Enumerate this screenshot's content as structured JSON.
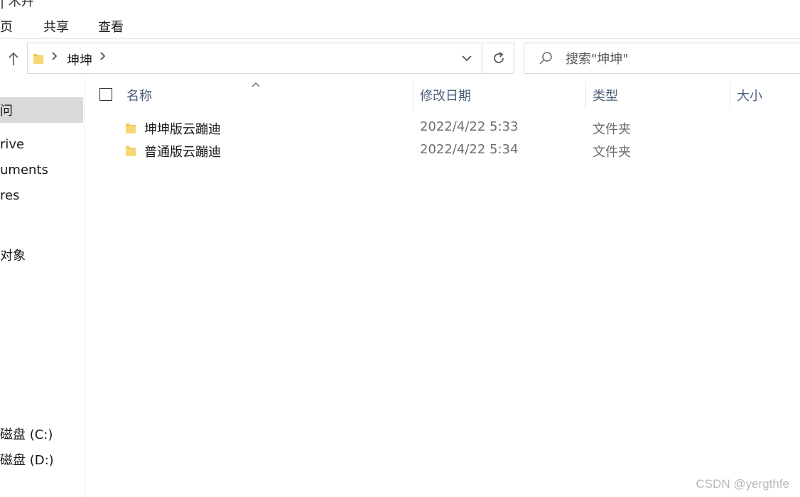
{
  "window": {
    "title_fragment": "|  木卉"
  },
  "ribbon": {
    "tabs": [
      {
        "label": "页"
      },
      {
        "label": "共享"
      },
      {
        "label": "查看"
      }
    ]
  },
  "address": {
    "crumb": "坤坤"
  },
  "search": {
    "placeholder": "搜索\"坤坤\""
  },
  "nav": {
    "items": [
      {
        "label": "问",
        "selected": true
      },
      {
        "label": "rive",
        "selected": false
      },
      {
        "label": "uments",
        "selected": false
      },
      {
        "label": "res",
        "selected": false
      },
      {
        "label": "对象",
        "selected": false
      },
      {
        "label": "磁盘 (C:)",
        "selected": false
      },
      {
        "label": "磁盘 (D:)",
        "selected": false
      }
    ]
  },
  "columns": {
    "name": "名称",
    "date": "修改日期",
    "type": "类型",
    "size": "大小"
  },
  "files": [
    {
      "name": "坤坤版云蹦迪",
      "date": "2022/4/22 5:33",
      "type": "文件夹",
      "size": ""
    },
    {
      "name": "普通版云蹦迪",
      "date": "2022/4/22 5:34",
      "type": "文件夹",
      "size": ""
    }
  ],
  "watermark": "CSDN @yergthfe",
  "colors": {
    "folder": "#f0c850",
    "header_text": "#4c607a",
    "selected_nav_bg": "#d9d9d9"
  },
  "icons": [
    "folder-icon",
    "chevron-right-icon",
    "chevron-down-icon",
    "refresh-icon",
    "search-icon",
    "up-arrow-icon",
    "sort-up-icon"
  ]
}
